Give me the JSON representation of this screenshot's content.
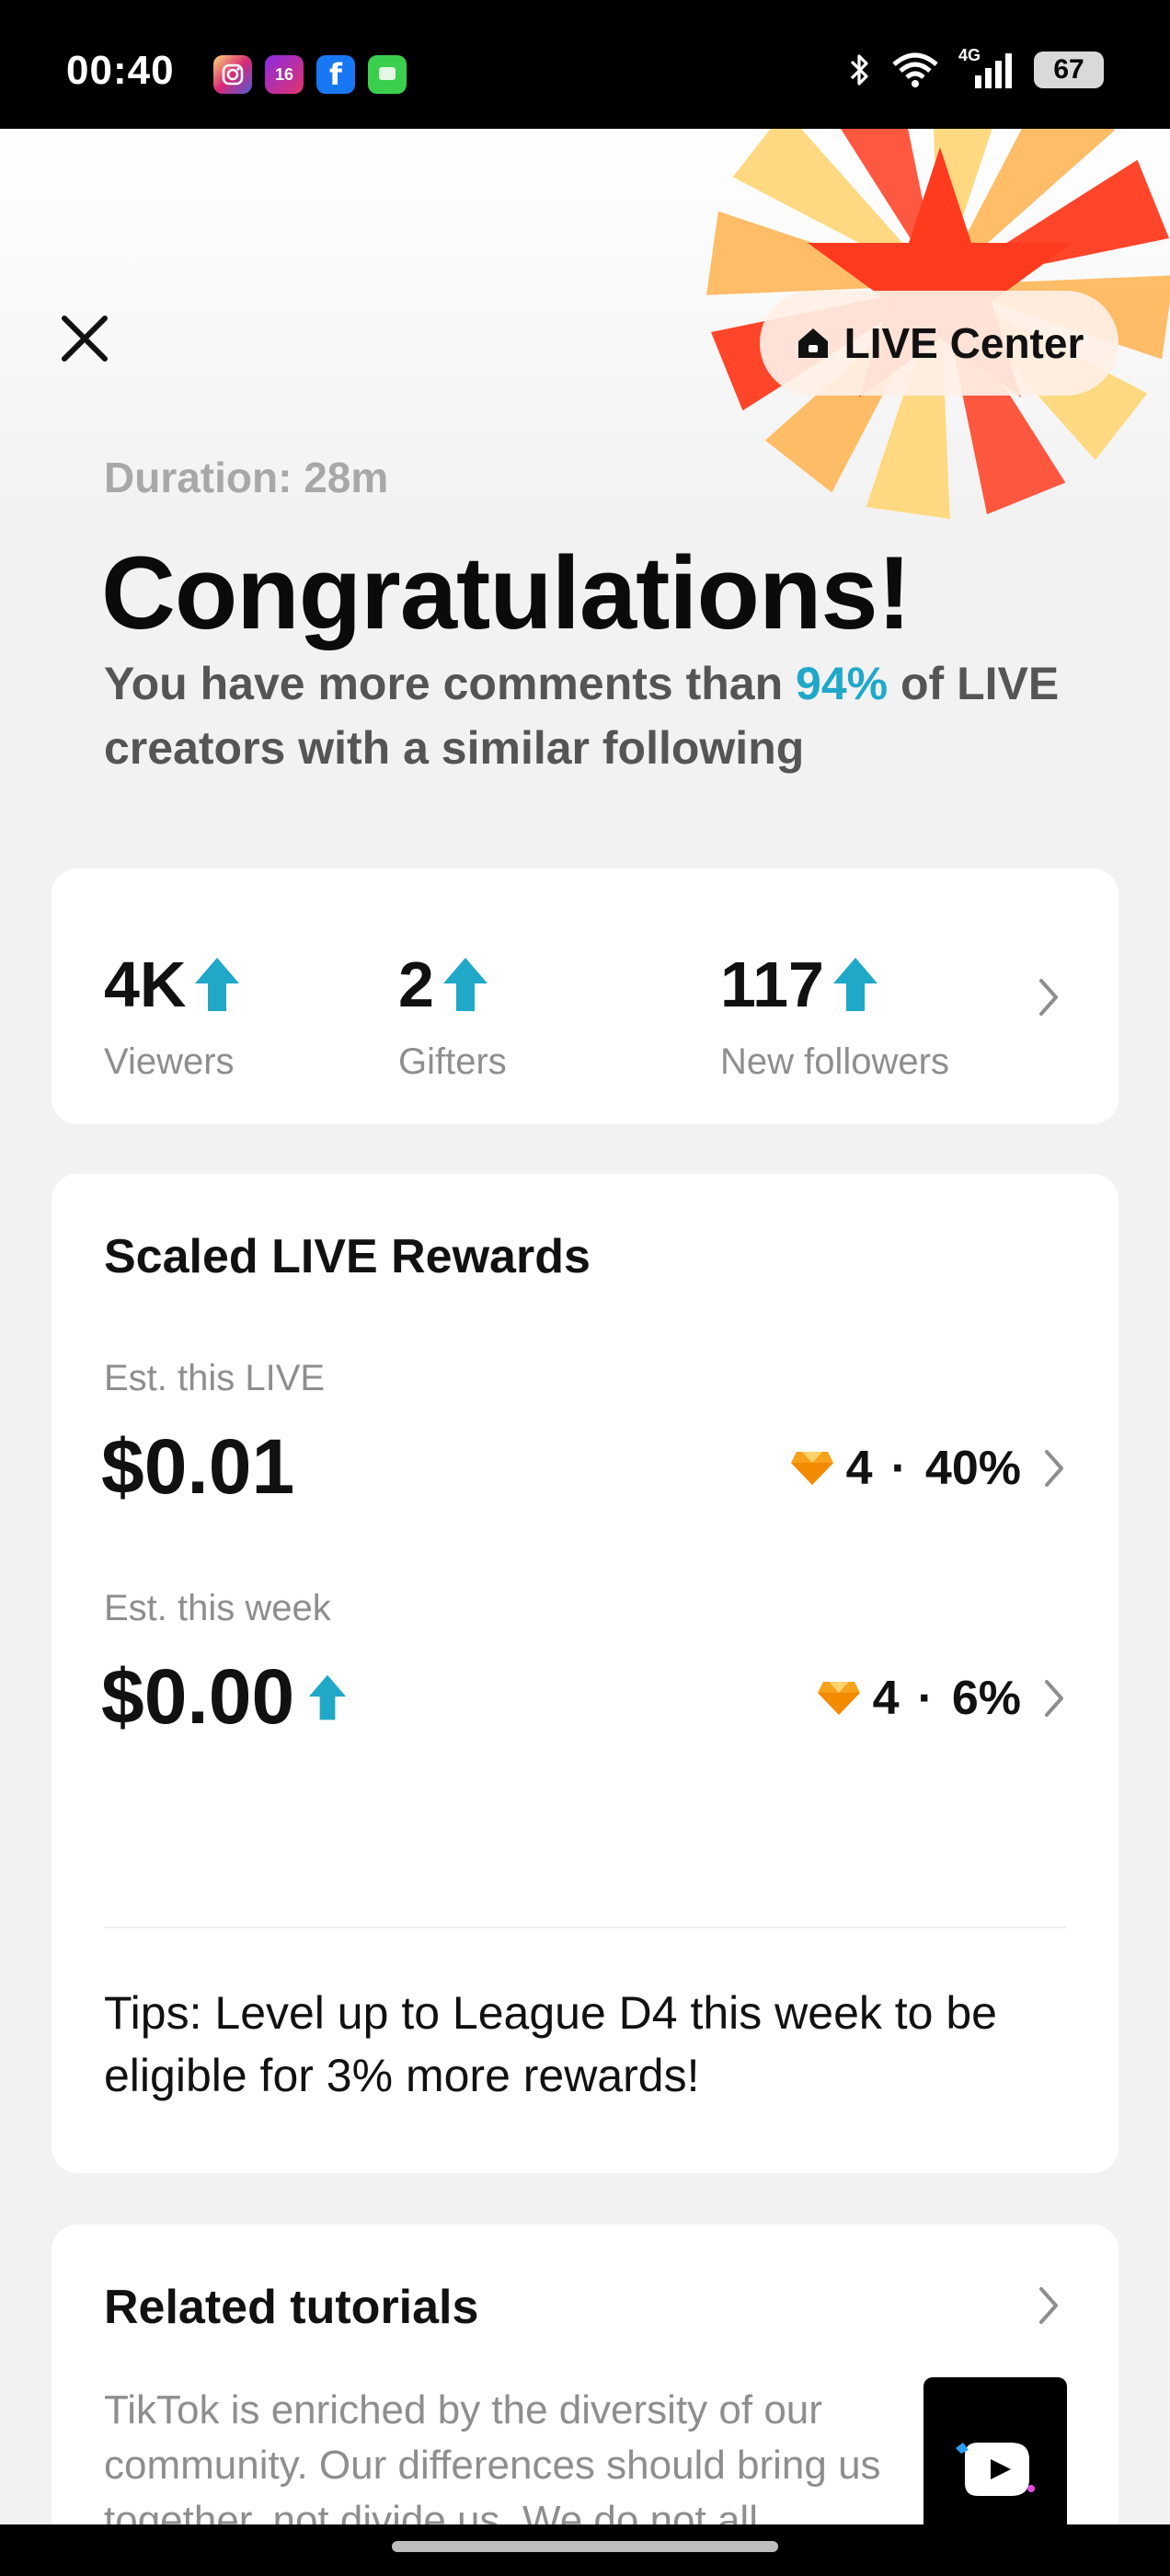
{
  "status_bar": {
    "time": "00:40",
    "apps": [
      "instagram-icon",
      "calendar-icon",
      "facebook-icon",
      "messages-icon"
    ],
    "calendar_day": "16",
    "network": "4G",
    "battery": "67"
  },
  "header": {
    "live_center_label": "LIVE Center"
  },
  "summary": {
    "duration": "Duration: 28m",
    "headline": "Congratulations!",
    "comment_text_before": "You have more comments than ",
    "comment_percent": "94%",
    "comment_text_after": " of LIVE creators with a similar following"
  },
  "stats": [
    {
      "value": "4K",
      "label": "Viewers",
      "trend": "up"
    },
    {
      "value": "2",
      "label": "Gifters",
      "trend": "up"
    },
    {
      "value": "117",
      "label": "New followers",
      "trend": "up"
    }
  ],
  "rewards": {
    "title": "Scaled LIVE Rewards",
    "live": {
      "label": "Est. this LIVE",
      "amount": "$0.01",
      "diamonds": "4",
      "separator": "·",
      "percent": "40%"
    },
    "week": {
      "label": "Est. this week",
      "amount": "$0.00",
      "diamonds": "4",
      "separator": "·",
      "percent": "6%"
    },
    "tips": "Tips: Level up to League D4 this week to be eligible for 3% more rewards!"
  },
  "tutorials": {
    "title": "Related tutorials",
    "text": "TikTok is enriched by the diversity of our community. Our differences should bring us together, not divide us. We do not all..."
  },
  "colors": {
    "accent": "#20a8c8",
    "burst_red": "#ff3b1f",
    "burst_orange": "#ffb14e",
    "burst_yellow": "#ffd77a"
  }
}
